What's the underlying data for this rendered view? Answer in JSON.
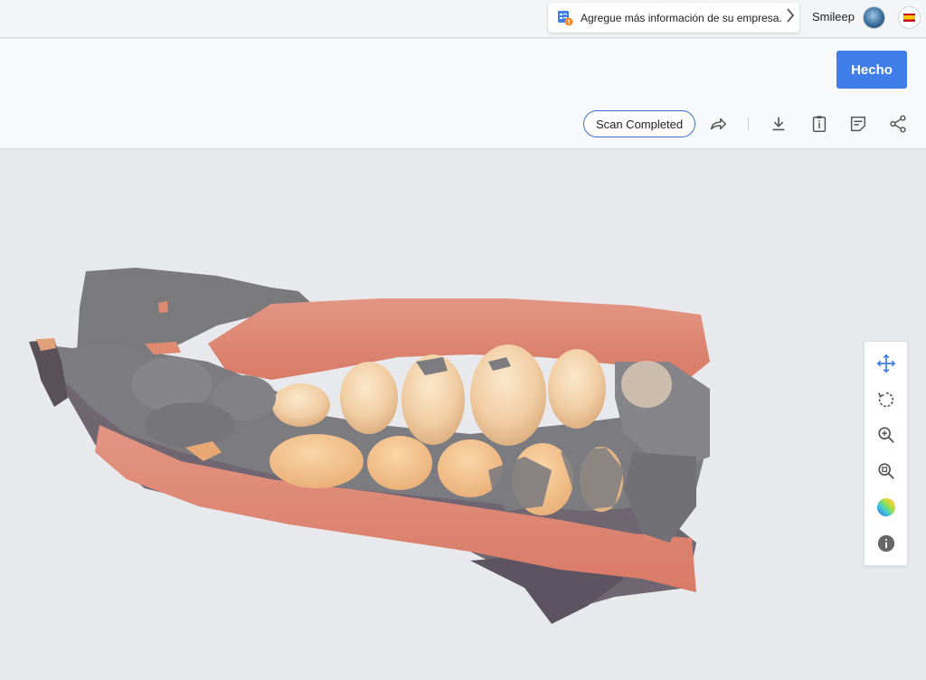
{
  "topbar": {
    "notice_text": "Agregue más información de su empresa.",
    "username": "Smileep"
  },
  "header": {
    "done_label": "Hecho",
    "status_label": "Scan Completed"
  },
  "colors": {
    "accent": "#3f7ee8",
    "pill_border": "#3d6fd0",
    "icon_active": "#3f7ee8",
    "icon_default": "#555555"
  },
  "toolbar_icons": [
    "redirect-arrow-icon",
    "download-icon",
    "clipboard-info-icon",
    "note-icon",
    "share-icon"
  ],
  "view_tools": [
    "move-icon",
    "rotate-icon",
    "zoom-in-icon",
    "zoom-fit-icon",
    "color-map-icon",
    "info-icon"
  ],
  "viewer": {
    "content": "3D dental intraoral scan"
  }
}
